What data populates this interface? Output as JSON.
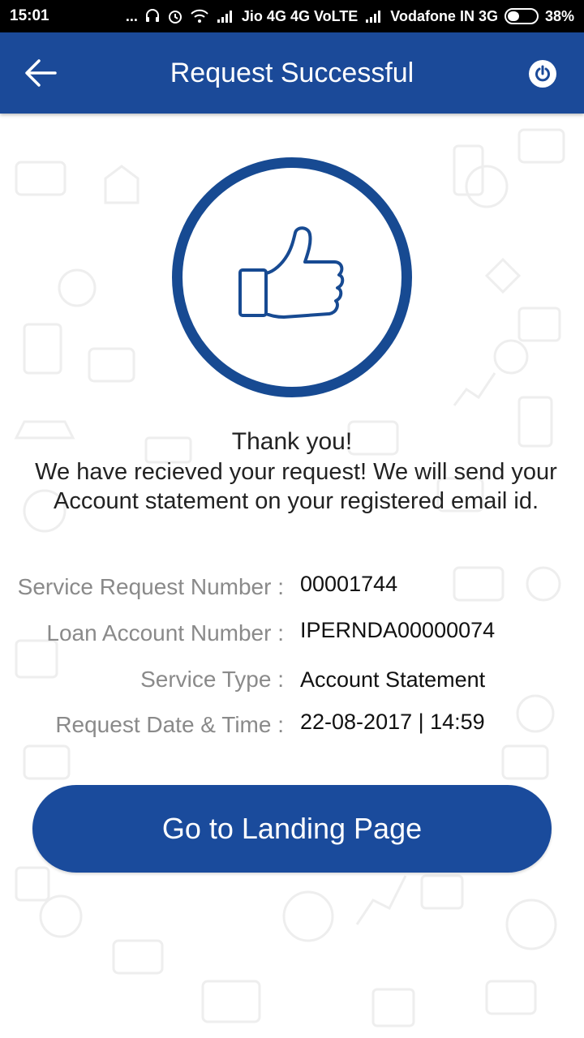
{
  "status_bar": {
    "time": "15:01",
    "dots": "...",
    "carrier1": "Jio 4G 4G VoLTE",
    "carrier2": "Vodafone IN 3G",
    "battery": "38%",
    "icons": [
      "headset-icon",
      "alarm-icon",
      "wifi-icon",
      "signal-icon",
      "battery-icon"
    ]
  },
  "header": {
    "title": "Request Successful",
    "back_icon": "arrow-left-icon",
    "power_icon": "power-icon"
  },
  "confirmation": {
    "icon": "thumbs-up-icon",
    "thanks": "Thank you!",
    "message": "We have recieved your request! We will send your Account statement on your registered email id."
  },
  "details": [
    {
      "label": "Service Request Number :",
      "value": "00001744"
    },
    {
      "label": "Loan Account Number :",
      "value": "IPERNDA00000074"
    },
    {
      "label": "Service Type :",
      "value": "Account Statement"
    },
    {
      "label": "Request Date & Time :",
      "value": "22-08-2017 | 14:59"
    }
  ],
  "button": {
    "label": "Go to Landing Page"
  },
  "colors": {
    "primary": "#1b4a99",
    "circle": "#174a92",
    "label": "#8a8a8a",
    "text": "#222222"
  }
}
